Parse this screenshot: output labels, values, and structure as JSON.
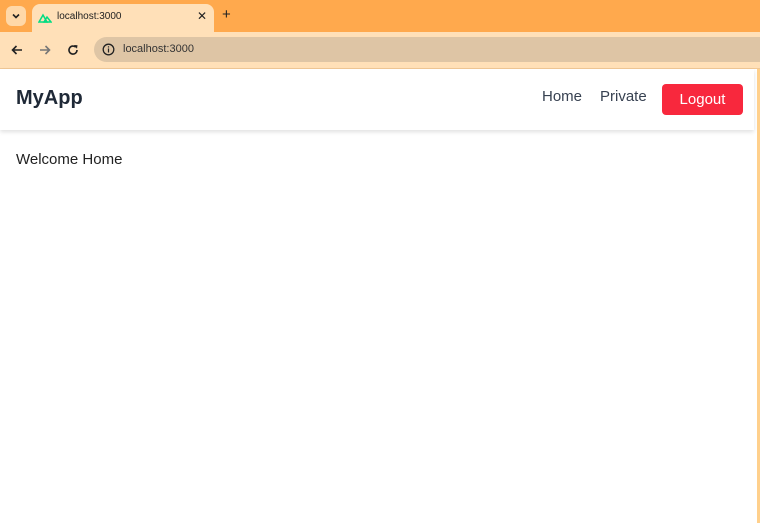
{
  "browser": {
    "tab": {
      "title": "localhost:3000",
      "close_glyph": "✕"
    },
    "new_tab_glyph": "+",
    "address": {
      "url": "localhost:3000"
    },
    "icons": [
      "chevron-down-icon",
      "nuxt-favicon-icon",
      "back-arrow-icon",
      "forward-arrow-icon",
      "reload-icon",
      "site-info-icon"
    ]
  },
  "app": {
    "brand": "MyApp",
    "nav": {
      "home": "Home",
      "private": "Private",
      "logout": "Logout"
    },
    "content": {
      "welcome": "Welcome Home"
    }
  },
  "colors": {
    "tabbar": "#ffa94d",
    "toolbar": "#ffe0b8",
    "omnibox": "#dec5a5",
    "logout_button": "#f8283d",
    "nuxt_green": "#00dc82"
  }
}
